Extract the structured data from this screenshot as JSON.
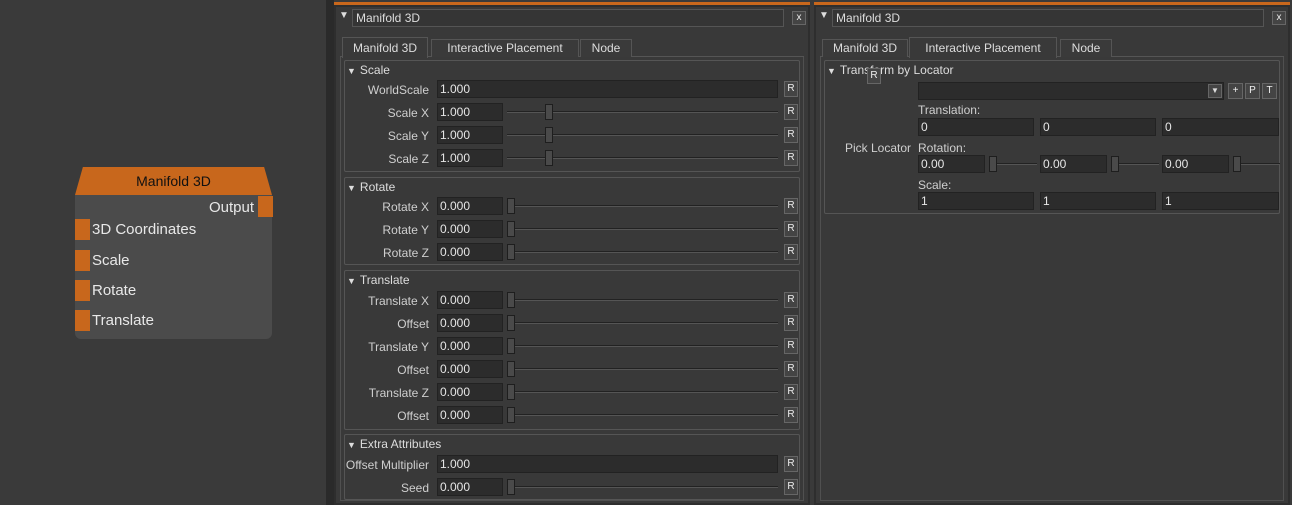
{
  "node": {
    "title": "Manifold 3D",
    "output": "Output",
    "inputs": [
      "3D Coordinates",
      "Scale",
      "Rotate",
      "Translate"
    ]
  },
  "panel1": {
    "title": "Manifold 3D",
    "close": "x",
    "tabs": [
      "Manifold 3D",
      "Interactive Placement",
      "Node"
    ],
    "reset": "R",
    "groups": {
      "scale": {
        "title": "Scale",
        "worldscale_label": "WorldScale",
        "worldscale_value": "1.000",
        "x_label": "Scale X",
        "x_value": "1.000",
        "y_label": "Scale Y",
        "y_value": "1.000",
        "z_label": "Scale Z",
        "z_value": "1.000"
      },
      "rotate": {
        "title": "Rotate",
        "x_label": "Rotate X",
        "x_value": "0.000",
        "y_label": "Rotate Y",
        "y_value": "0.000",
        "z_label": "Rotate Z",
        "z_value": "0.000"
      },
      "translate": {
        "title": "Translate",
        "x_label": "Translate X",
        "x_value": "0.000",
        "x_offset_label": "Offset",
        "x_offset_value": "0.000",
        "y_label": "Translate Y",
        "y_value": "0.000",
        "y_offset_label": "Offset",
        "y_offset_value": "0.000",
        "z_label": "Translate Z",
        "z_value": "0.000",
        "z_offset_label": "Offset",
        "z_offset_value": "0.000"
      },
      "extra": {
        "title": "Extra Attributes",
        "offset_mult_label": "Offset Multiplier",
        "offset_mult_value": "1.000",
        "seed_label": "Seed",
        "seed_value": "0.000"
      }
    }
  },
  "panel2": {
    "title": "Manifold 3D",
    "close": "x",
    "tabs": [
      "Manifold 3D",
      "Interactive Placement",
      "Node"
    ],
    "group_title": "Transform by Locator",
    "reset": "R",
    "pick_locator": "Pick Locator",
    "buttons": [
      "+",
      "P",
      "T"
    ],
    "translation_label": "Translation:",
    "translation": [
      "0",
      "0",
      "0"
    ],
    "rotation_label": "Rotation:",
    "rotation": [
      "0.00",
      "0.00",
      "0.00"
    ],
    "scale_label": "Scale:",
    "scale": [
      "1",
      "1",
      "1"
    ]
  }
}
